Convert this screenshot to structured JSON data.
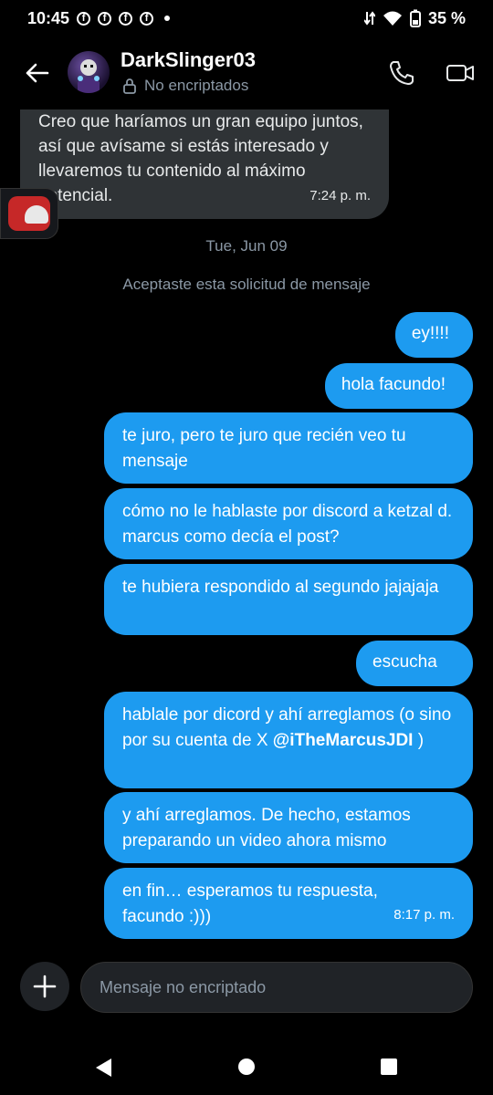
{
  "status_bar": {
    "time": "10:45",
    "notification_icons": [
      "f",
      "f",
      "f",
      "f"
    ],
    "battery": "35 %"
  },
  "header": {
    "name": "DarkSlinger03",
    "encryption_status": "No encriptados"
  },
  "messages": {
    "incoming": {
      "text": "Creo que haríamos un gran equipo juntos, así que avísame si estás interesado y llevaremos tu contenido al máximo potencial.",
      "time": "7:24 p. m."
    },
    "date_separator": "Tue, Jun 09",
    "request_note": "Aceptaste esta solicitud de mensaje",
    "outgoing": [
      {
        "text": "ey!!!!"
      },
      {
        "text": "hola facundo!"
      },
      {
        "text": "te juro, pero te juro que recién veo tu mensaje"
      },
      {
        "text": "cómo no le hablaste por discord a ketzal d. marcus como decía el post?"
      },
      {
        "text": "te hubiera respondido al segundo jajajaja"
      },
      {
        "text": "escucha"
      },
      {
        "text_before": "hablale por dicord y ahí arreglamos (o sino por su cuenta de X ",
        "mention": "@iTheMarcusJDI",
        "text_after": " )"
      },
      {
        "text": "y ahí arreglamos. De hecho, estamos preparando un video ahora mismo"
      },
      {
        "text": "en fin… esperamos tu respuesta, facundo :)))",
        "time": "8:17 p. m."
      }
    ]
  },
  "composer": {
    "placeholder": "Mensaje no encriptado"
  },
  "colors": {
    "accent": "#1d9bf0",
    "incoming_bubble": "#2f3336",
    "background": "#000000",
    "muted_text": "#8b98a5"
  }
}
